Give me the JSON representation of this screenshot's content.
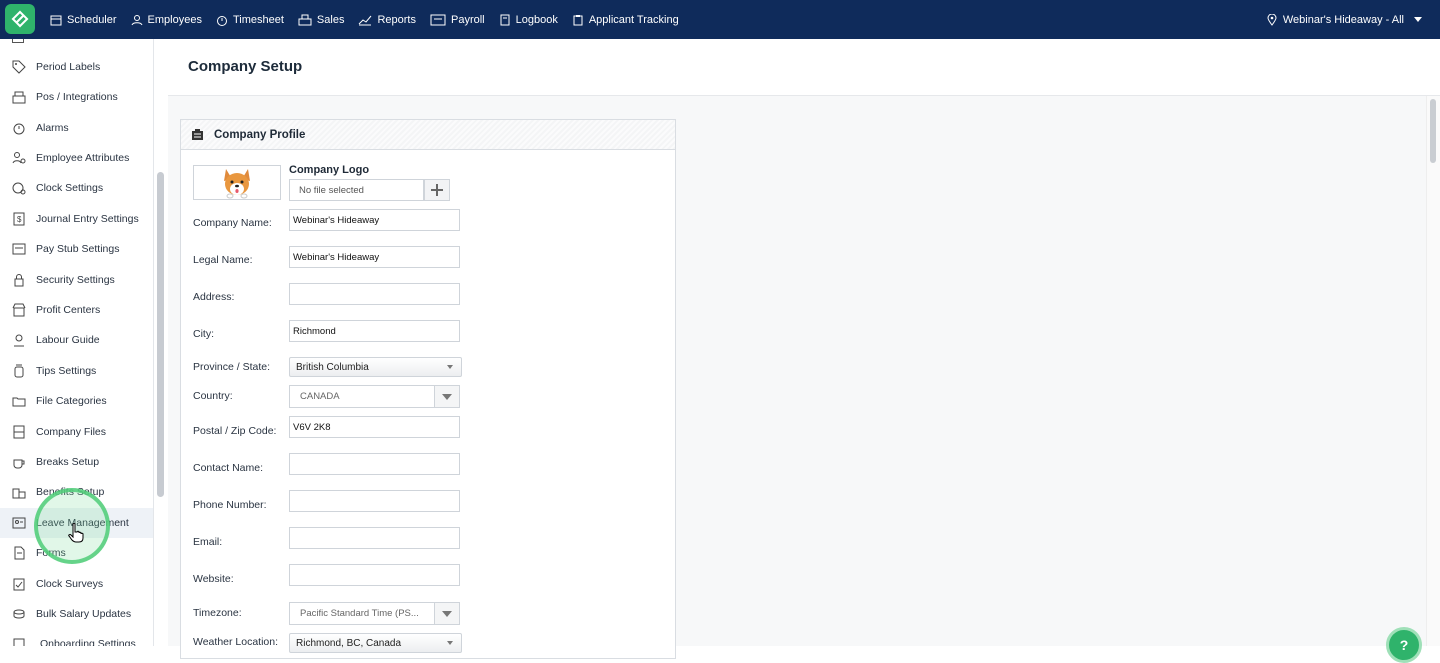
{
  "topnav": {
    "items": [
      {
        "label": "Scheduler",
        "icon": "calendar-icon"
      },
      {
        "label": "Employees",
        "icon": "user-icon"
      },
      {
        "label": "Timesheet",
        "icon": "stopwatch-icon"
      },
      {
        "label": "Sales",
        "icon": "register-icon"
      },
      {
        "label": "Reports",
        "icon": "chart-line-icon"
      },
      {
        "label": "Payroll",
        "icon": "id-card-icon"
      },
      {
        "label": "Logbook",
        "icon": "book-icon"
      },
      {
        "label": "Applicant Tracking",
        "icon": "clipboard-icon"
      }
    ],
    "location": "Webinar's Hideaway - All"
  },
  "sidebar": {
    "items": [
      {
        "label": "Period Labels"
      },
      {
        "label": "Pos / Integrations"
      },
      {
        "label": "Alarms"
      },
      {
        "label": "Employee Attributes"
      },
      {
        "label": "Clock Settings"
      },
      {
        "label": "Journal Entry Settings"
      },
      {
        "label": "Pay Stub Settings"
      },
      {
        "label": "Security Settings"
      },
      {
        "label": "Profit Centers"
      },
      {
        "label": "Labour Guide"
      },
      {
        "label": "Tips Settings"
      },
      {
        "label": "File Categories"
      },
      {
        "label": "Company Files"
      },
      {
        "label": "Breaks Setup"
      },
      {
        "label": "Benefits Setup"
      },
      {
        "label": "Leave Management"
      },
      {
        "label": "Forms"
      },
      {
        "label": "Clock Surveys"
      },
      {
        "label": "Bulk Salary Updates"
      },
      {
        "label": "Onboarding Settings"
      }
    ]
  },
  "page": {
    "title": "Company Setup"
  },
  "panel": {
    "title": "Company Profile",
    "logo_label": "Company Logo",
    "file_placeholder": "No file selected",
    "fields": {
      "company_name": {
        "label": "Company Name:",
        "value": "Webinar's Hideaway"
      },
      "legal_name": {
        "label": "Legal Name:",
        "value": "Webinar's Hideaway"
      },
      "address": {
        "label": "Address:",
        "value": ""
      },
      "city": {
        "label": "City:",
        "value": "Richmond"
      },
      "province": {
        "label": "Province / State:",
        "value": "British Columbia"
      },
      "country": {
        "label": "Country:",
        "value": "CANADA"
      },
      "postal": {
        "label": "Postal / Zip Code:",
        "value": "V6V 2K8"
      },
      "contact": {
        "label": "Contact Name:",
        "value": ""
      },
      "phone": {
        "label": "Phone Number:",
        "value": ""
      },
      "email": {
        "label": "Email:",
        "value": ""
      },
      "website": {
        "label": "Website:",
        "value": ""
      },
      "timezone": {
        "label": "Timezone:",
        "value": "Pacific Standard Time (PS..."
      },
      "weather": {
        "label": "Weather Location:",
        "value": "Richmond, BC, Canada"
      }
    }
  },
  "help": {
    "label": "?"
  },
  "colors": {
    "nav_bg": "#0f2b5b",
    "brand_green": "#2fb36b"
  }
}
